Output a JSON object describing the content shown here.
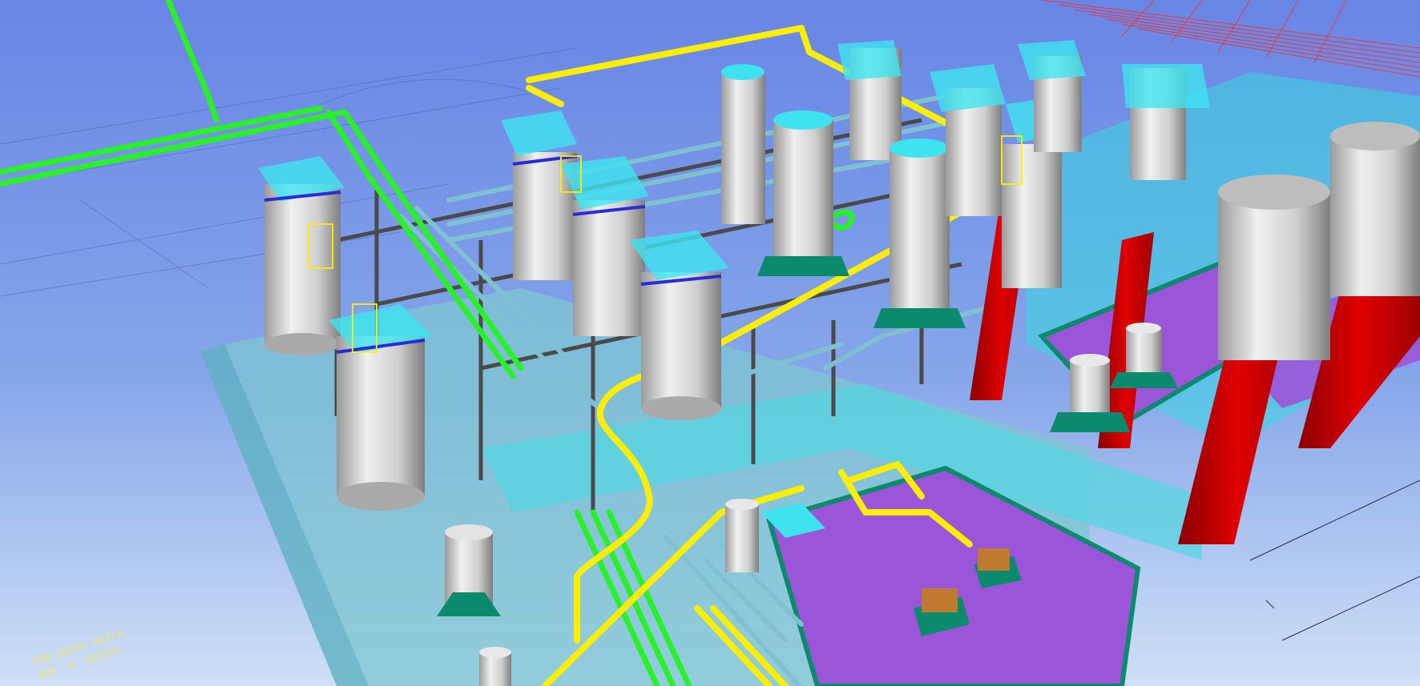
{
  "viewport": {
    "background_top": "#6e8be6",
    "background_bottom": "#c9dcf5"
  },
  "colors": {
    "vessel_body": "#d3d3d3",
    "vessel_shade": "#8e8e8e",
    "vessel_top_glass": "#3fe3f0",
    "vessel_ring": "#2b2bd6",
    "pipe_yellow": "#ffee00",
    "pipe_green": "#22ee22",
    "pipe_steel": "#7fb5c7",
    "structure_dark": "#4b4b4b",
    "column_red": "#d40000",
    "floor_cyan": "#62d6d8",
    "floor_purple": "#9a4fd6",
    "foundation_teal": "#0c8a6e",
    "rebar_red": "#ff2020"
  },
  "annotations": {
    "note_line_1": "FOR ENTRY HATCH",
    "note_line_2": "SEE 'A' DETAIL"
  }
}
